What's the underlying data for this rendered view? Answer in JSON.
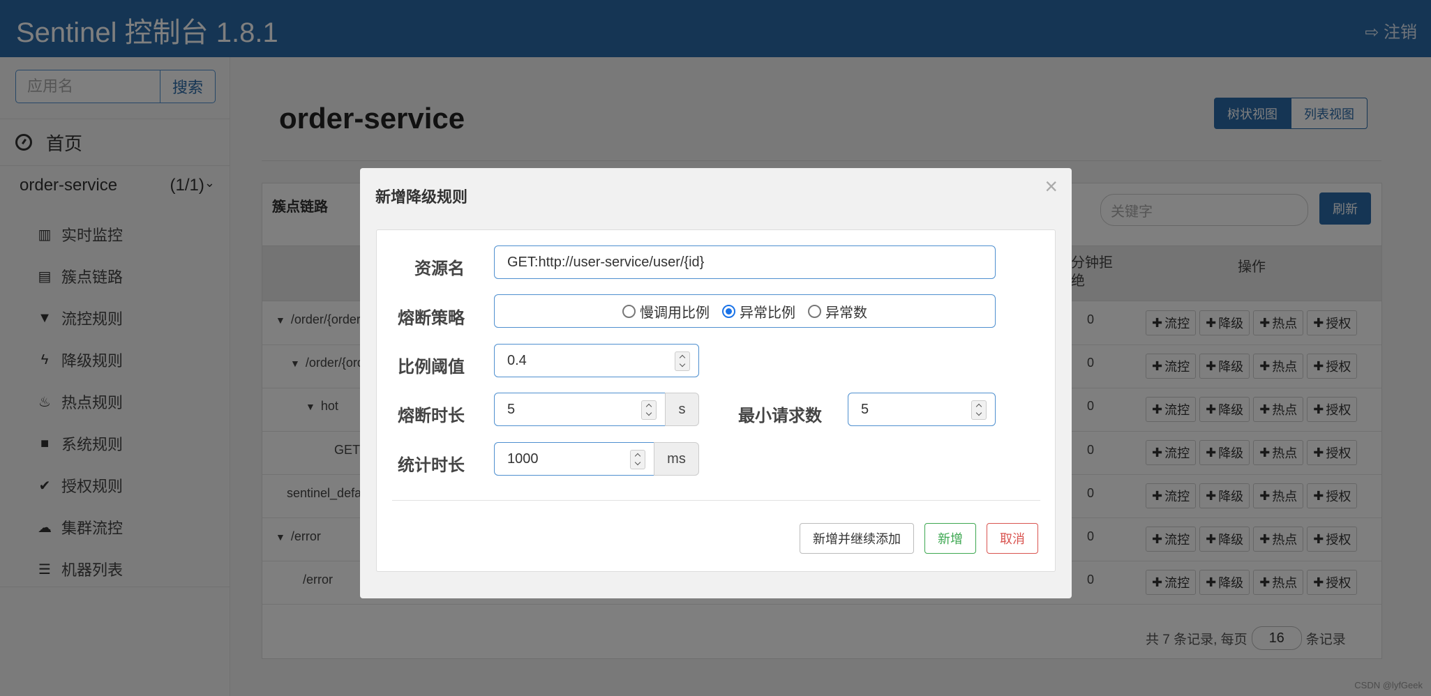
{
  "header": {
    "brand": "Sentinel 控制台 1.8.1",
    "logout_label": "注销"
  },
  "sidebar": {
    "search_placeholder": "应用名",
    "search_button": "搜索",
    "home_label": "首页",
    "app_name": "order-service",
    "app_count": "(1/1)",
    "items": [
      {
        "label": "实时监控",
        "icon": "bar-chart-icon"
      },
      {
        "label": "簇点链路",
        "icon": "list-icon"
      },
      {
        "label": "流控规则",
        "icon": "filter-icon"
      },
      {
        "label": "降级规则",
        "icon": "flash-icon"
      },
      {
        "label": "热点规则",
        "icon": "fire-icon"
      },
      {
        "label": "系统规则",
        "icon": "lock-icon"
      },
      {
        "label": "授权规则",
        "icon": "check-icon"
      },
      {
        "label": "集群流控",
        "icon": "cloud-icon"
      },
      {
        "label": "机器列表",
        "icon": "list-icon"
      }
    ]
  },
  "main": {
    "title": "order-service",
    "view_tree": "树状视图",
    "view_list": "列表视图",
    "panel_label": "簇点链路",
    "keyword_placeholder": "关键字",
    "refresh": "刷新",
    "col_reject": "分钟拒绝",
    "col_ops": "操作",
    "rows": [
      {
        "name": "/order/{order",
        "count": "0"
      },
      {
        "name": "/order/{ord",
        "count": "0"
      },
      {
        "name": "hot",
        "count": "0"
      },
      {
        "name": "GET",
        "count": "0"
      },
      {
        "name": "sentinel_defa",
        "count": "0"
      },
      {
        "name": "/error",
        "count": "0"
      },
      {
        "name": "/error",
        "count": "0"
      }
    ],
    "op_labels": [
      "流控",
      "降级",
      "热点",
      "授权"
    ],
    "pager": {
      "prefix": "共 7 条记录, 每页",
      "page_size": "16",
      "suffix": "条记录"
    }
  },
  "modal": {
    "title": "新增降级规则",
    "close": "×",
    "resource_label": "资源名",
    "resource_value": "GET:http://user-service/user/{id}",
    "strategy_label": "熔断策略",
    "strategy_options": [
      "慢调用比例",
      "异常比例",
      "异常数"
    ],
    "strategy_selected": "异常比例",
    "ratio_label": "比例阈值",
    "ratio_value": "0.4",
    "duration_label": "熔断时长",
    "duration_value": "5",
    "duration_unit": "s",
    "min_req_label": "最小请求数",
    "min_req_value": "5",
    "stat_label": "统计时长",
    "stat_value": "1000",
    "stat_unit": "ms",
    "btn_add_continue": "新增并继续添加",
    "btn_add": "新增",
    "btn_cancel": "取消"
  },
  "watermark": "CSDN @lyfGeek"
}
